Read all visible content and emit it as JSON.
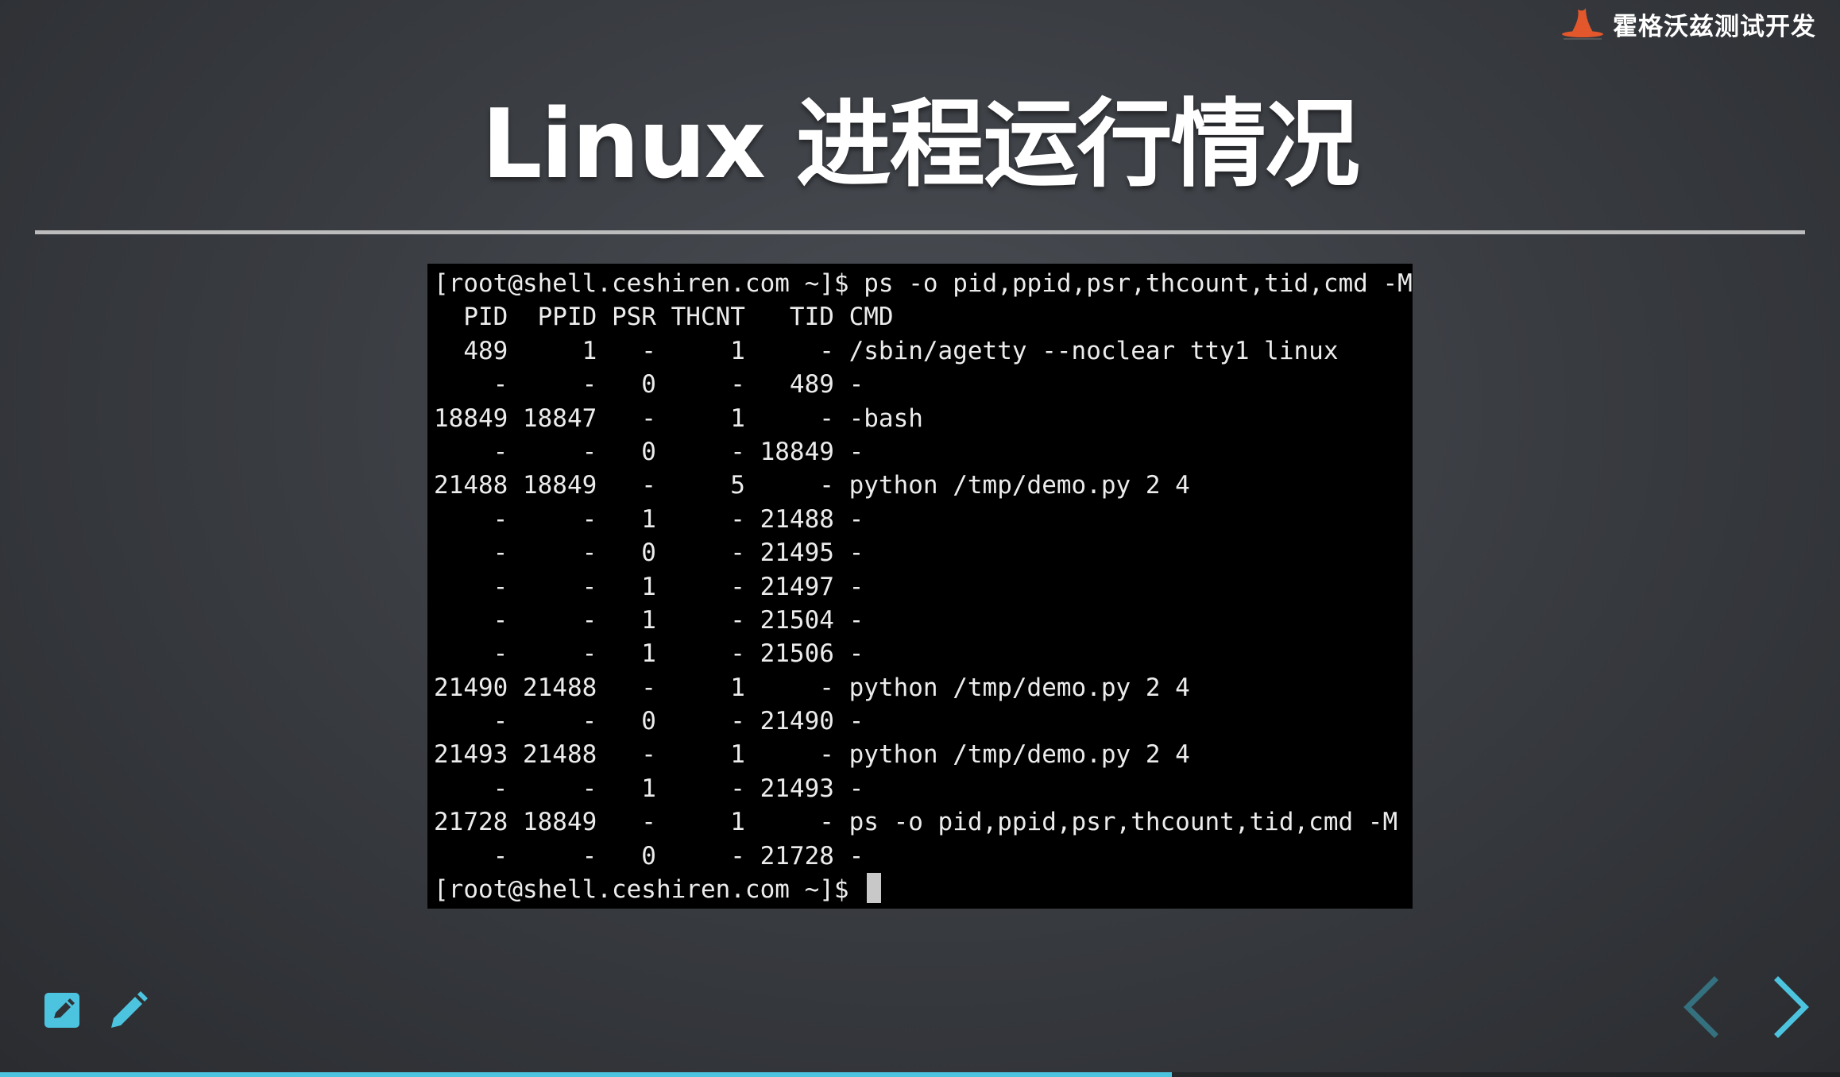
{
  "brand": {
    "name": "霍格沃兹测试开发"
  },
  "slide": {
    "title": "Linux 进程运行情况"
  },
  "terminal": {
    "lines": [
      "[root@shell.ceshiren.com ~]$ ps -o pid,ppid,psr,thcount,tid,cmd -M",
      "  PID  PPID PSR THCNT   TID CMD",
      "  489     1   -     1     - /sbin/agetty --noclear tty1 linux",
      "    -     -   0     -   489 -",
      "18849 18847   -     1     - -bash",
      "    -     -   0     - 18849 -",
      "21488 18849   -     5     - python /tmp/demo.py 2 4",
      "    -     -   1     - 21488 -",
      "    -     -   0     - 21495 -",
      "    -     -   1     - 21497 -",
      "    -     -   1     - 21504 -",
      "    -     -   1     - 21506 -",
      "21490 21488   -     1     - python /tmp/demo.py 2 4",
      "    -     -   0     - 21490 -",
      "21493 21488   -     1     - python /tmp/demo.py 2 4",
      "    -     -   1     - 21493 -",
      "21728 18849   -     1     - ps -o pid,ppid,psr,thcount,tid,cmd -M",
      "    -     -   0     - 21728 -"
    ],
    "prompt": "[root@shell.ceshiren.com ~]$ "
  },
  "toolbar": {
    "edit_icon": "edit-slide-icon",
    "pencil_icon": "pencil-icon"
  },
  "nav": {
    "prev_icon": "chevron-left-icon",
    "next_icon": "chevron-right-icon"
  },
  "progress": {
    "fraction": 0.637
  },
  "colors": {
    "accent": "#4dc4df",
    "logo": "#e2572b",
    "background": "#3a3d42"
  }
}
